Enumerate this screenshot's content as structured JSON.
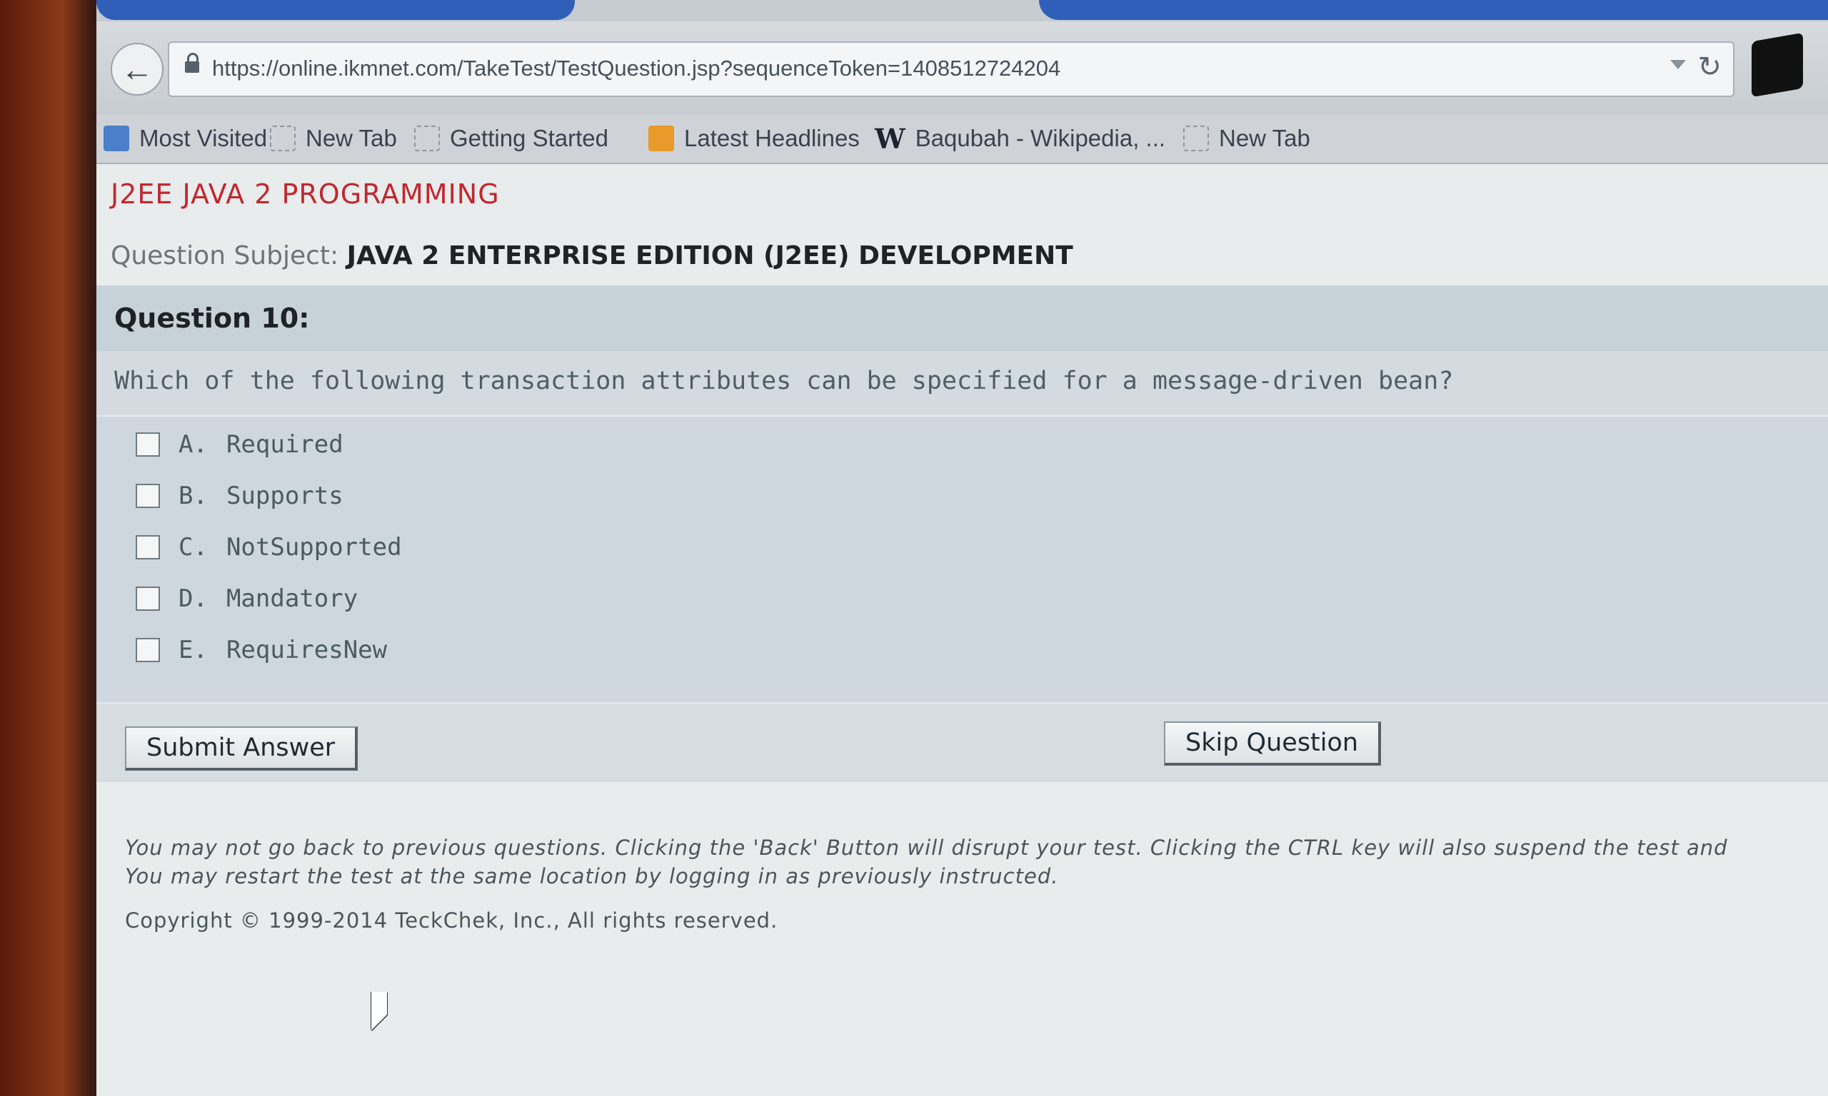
{
  "browser": {
    "url": "https://online.ikmnet.com/TakeTest/TestQuestion.jsp?sequenceToken=1408512724204",
    "bookmarks": [
      {
        "label": "Most Visited",
        "icon": "most-visited-icon"
      },
      {
        "label": "New Tab",
        "icon": "blank-page-icon"
      },
      {
        "label": "Getting Started",
        "icon": "blank-page-icon"
      },
      {
        "label": "Latest Headlines",
        "icon": "rss-icon"
      },
      {
        "label": "Baqubah - Wikipedia, ...",
        "icon": "wikipedia-icon",
        "glyph": "W"
      },
      {
        "label": "New Tab",
        "icon": "blank-page-icon"
      }
    ]
  },
  "test": {
    "course_title": "J2EE JAVA 2 PROGRAMMING",
    "subject_label": "Question Subject:",
    "subject_value": "JAVA 2 ENTERPRISE EDITION (J2EE) DEVELOPMENT",
    "question_number": "Question 10:",
    "question_text": "Which of the following transaction attributes can be specified for a message-driven bean?",
    "options": [
      {
        "letter": "A.",
        "text": "Required",
        "checked": false
      },
      {
        "letter": "B.",
        "text": "Supports",
        "checked": false
      },
      {
        "letter": "C.",
        "text": "NotSupported",
        "checked": false
      },
      {
        "letter": "D.",
        "text": "Mandatory",
        "checked": false
      },
      {
        "letter": "E.",
        "text": "RequiresNew",
        "checked": false
      }
    ],
    "submit_label": "Submit Answer",
    "skip_label": "Skip Question",
    "notice_line1": "You may not go back to previous questions. Clicking the 'Back' Button will disrupt your test. Clicking the CTRL key will also suspend the test and",
    "notice_line2": "You may restart the test at the same location by logging in as previously instructed.",
    "copyright": "Copyright © 1999-2014 TeckChek, Inc., All rights reserved."
  },
  "colors": {
    "course_title": "#c0282f",
    "question_header_bg": "#c7d1d8",
    "tab_accent": "#2f5fb8"
  }
}
